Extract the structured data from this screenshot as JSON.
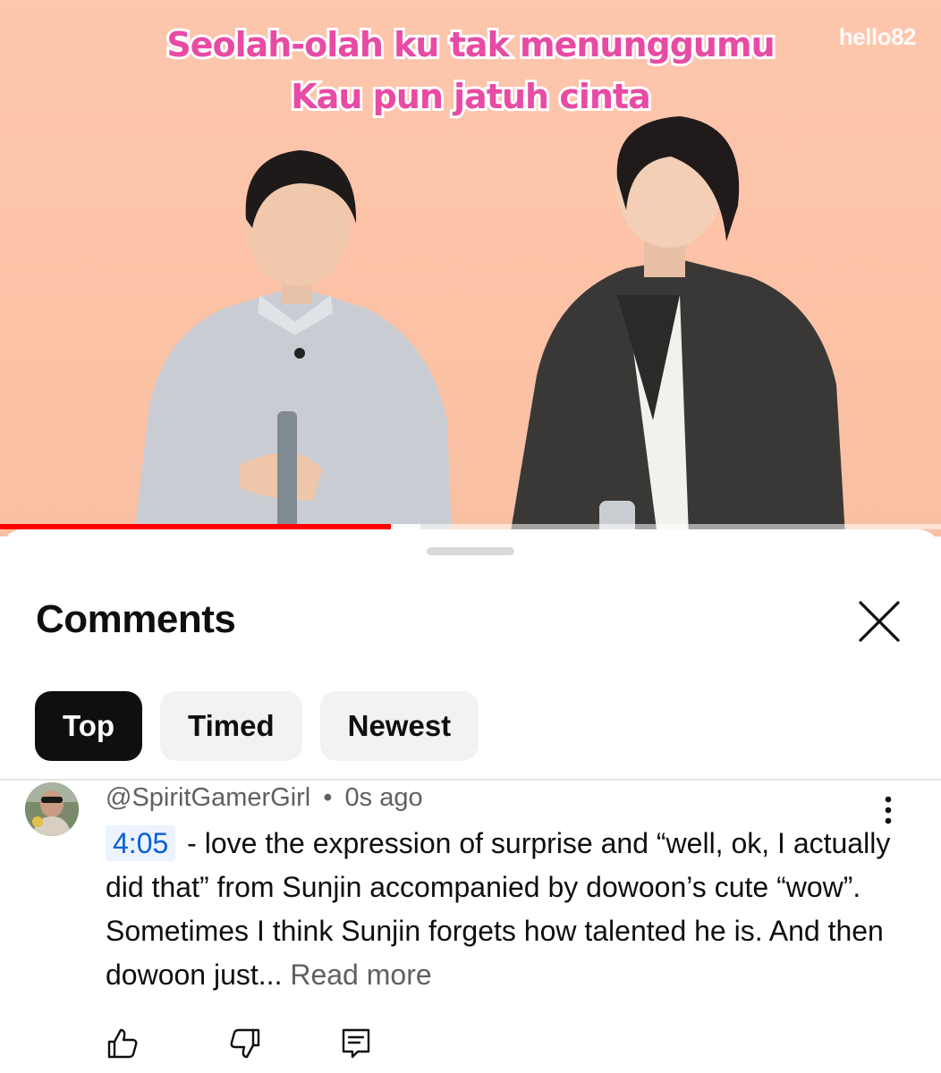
{
  "video": {
    "subtitle_line1": "Seolah-olah ku tak menunggumu",
    "subtitle_line2": "Kau pun jatuh cinta",
    "watermark": "hello82",
    "progress_fraction": 0.415,
    "buffered_fraction": 0.447
  },
  "sheet": {
    "title": "Comments",
    "tabs": [
      {
        "label": "Top",
        "active": true
      },
      {
        "label": "Timed",
        "active": false
      },
      {
        "label": "Newest",
        "active": false
      }
    ]
  },
  "comment": {
    "author": "@SpiritGamerGirl",
    "separator": "•",
    "time": "0s ago",
    "timestamp": "4:05",
    "text": " - love the expression of surprise and “well, ok, I actually did that” from Sunjin accompanied by dowoon’s cute “wow”. Sometimes I think Sunjin forgets how talented he is. And then dowoon just...",
    "read_more": "Read more"
  },
  "icons": {
    "close": "close-icon",
    "more": "more-vert-icon",
    "like": "thumbs-up-icon",
    "dislike": "thumbs-down-icon",
    "reply": "reply-comment-icon"
  },
  "colors": {
    "progress": "#ff0000",
    "timestamp_link": "#065fd4",
    "subtitle": "#e84ba3",
    "video_bg": "#fcc2a6"
  }
}
